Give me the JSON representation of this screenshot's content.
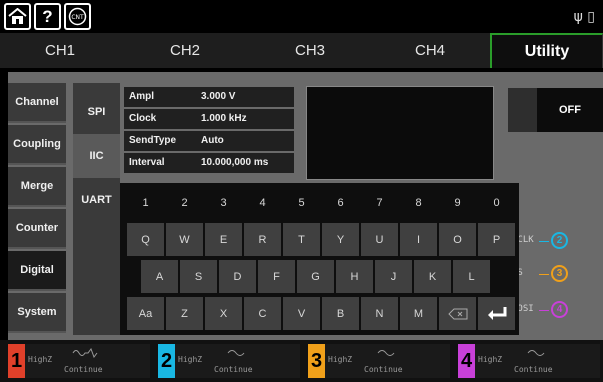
{
  "topbar": {
    "icons": [
      "home-icon",
      "help-icon",
      "counter-icon"
    ],
    "counter_label": "CNT",
    "usb_glyph": "ψ"
  },
  "tabs": [
    {
      "label": "CH1",
      "active": false
    },
    {
      "label": "CH2",
      "active": false
    },
    {
      "label": "CH3",
      "active": false
    },
    {
      "label": "CH4",
      "active": false
    },
    {
      "label": "Utility",
      "active": true
    }
  ],
  "menu": {
    "items": [
      "Channel",
      "Coupling",
      "Merge",
      "Counter",
      "Digital",
      "System"
    ],
    "selected": "Digital"
  },
  "submenu": {
    "items": [
      "SPI",
      "IIC",
      "UART"
    ],
    "selected": "IIC"
  },
  "params": [
    {
      "label": "Ampl",
      "value": "3.000 V"
    },
    {
      "label": "Clock",
      "value": "1.000 kHz"
    },
    {
      "label": "SendType",
      "value": "Auto"
    },
    {
      "label": "Interval",
      "value": "10.000,000 ms"
    }
  ],
  "output_toggle": "OFF",
  "signals": [
    {
      "label": "SCLK",
      "pin": "2",
      "color": "#19b7e3"
    },
    {
      "label": "CS",
      "pin": "3",
      "color": "#f0a01a"
    },
    {
      "label": "MOSI",
      "pin": "4",
      "color": "#c840d8"
    }
  ],
  "keyboard": {
    "row1": [
      "1",
      "2",
      "3",
      "4",
      "5",
      "6",
      "7",
      "8",
      "9",
      "0"
    ],
    "row2": [
      "Q",
      "W",
      "E",
      "R",
      "T",
      "Y",
      "U",
      "I",
      "O",
      "P"
    ],
    "row3": [
      "A",
      "S",
      "D",
      "F",
      "G",
      "H",
      "J",
      "K",
      "L"
    ],
    "row4": [
      "Aa",
      "Z",
      "X",
      "C",
      "V",
      "B",
      "N",
      "M"
    ]
  },
  "channels": [
    {
      "number": "1",
      "impedance": "HighZ",
      "mode": "Continue",
      "color": "#e0402a"
    },
    {
      "number": "2",
      "impedance": "HighZ",
      "mode": "Continue",
      "color": "#19b7e3"
    },
    {
      "number": "3",
      "impedance": "HighZ",
      "mode": "Continue",
      "color": "#f0a01a"
    },
    {
      "number": "4",
      "impedance": "HighZ",
      "mode": "Continue",
      "color": "#c840d8"
    }
  ]
}
